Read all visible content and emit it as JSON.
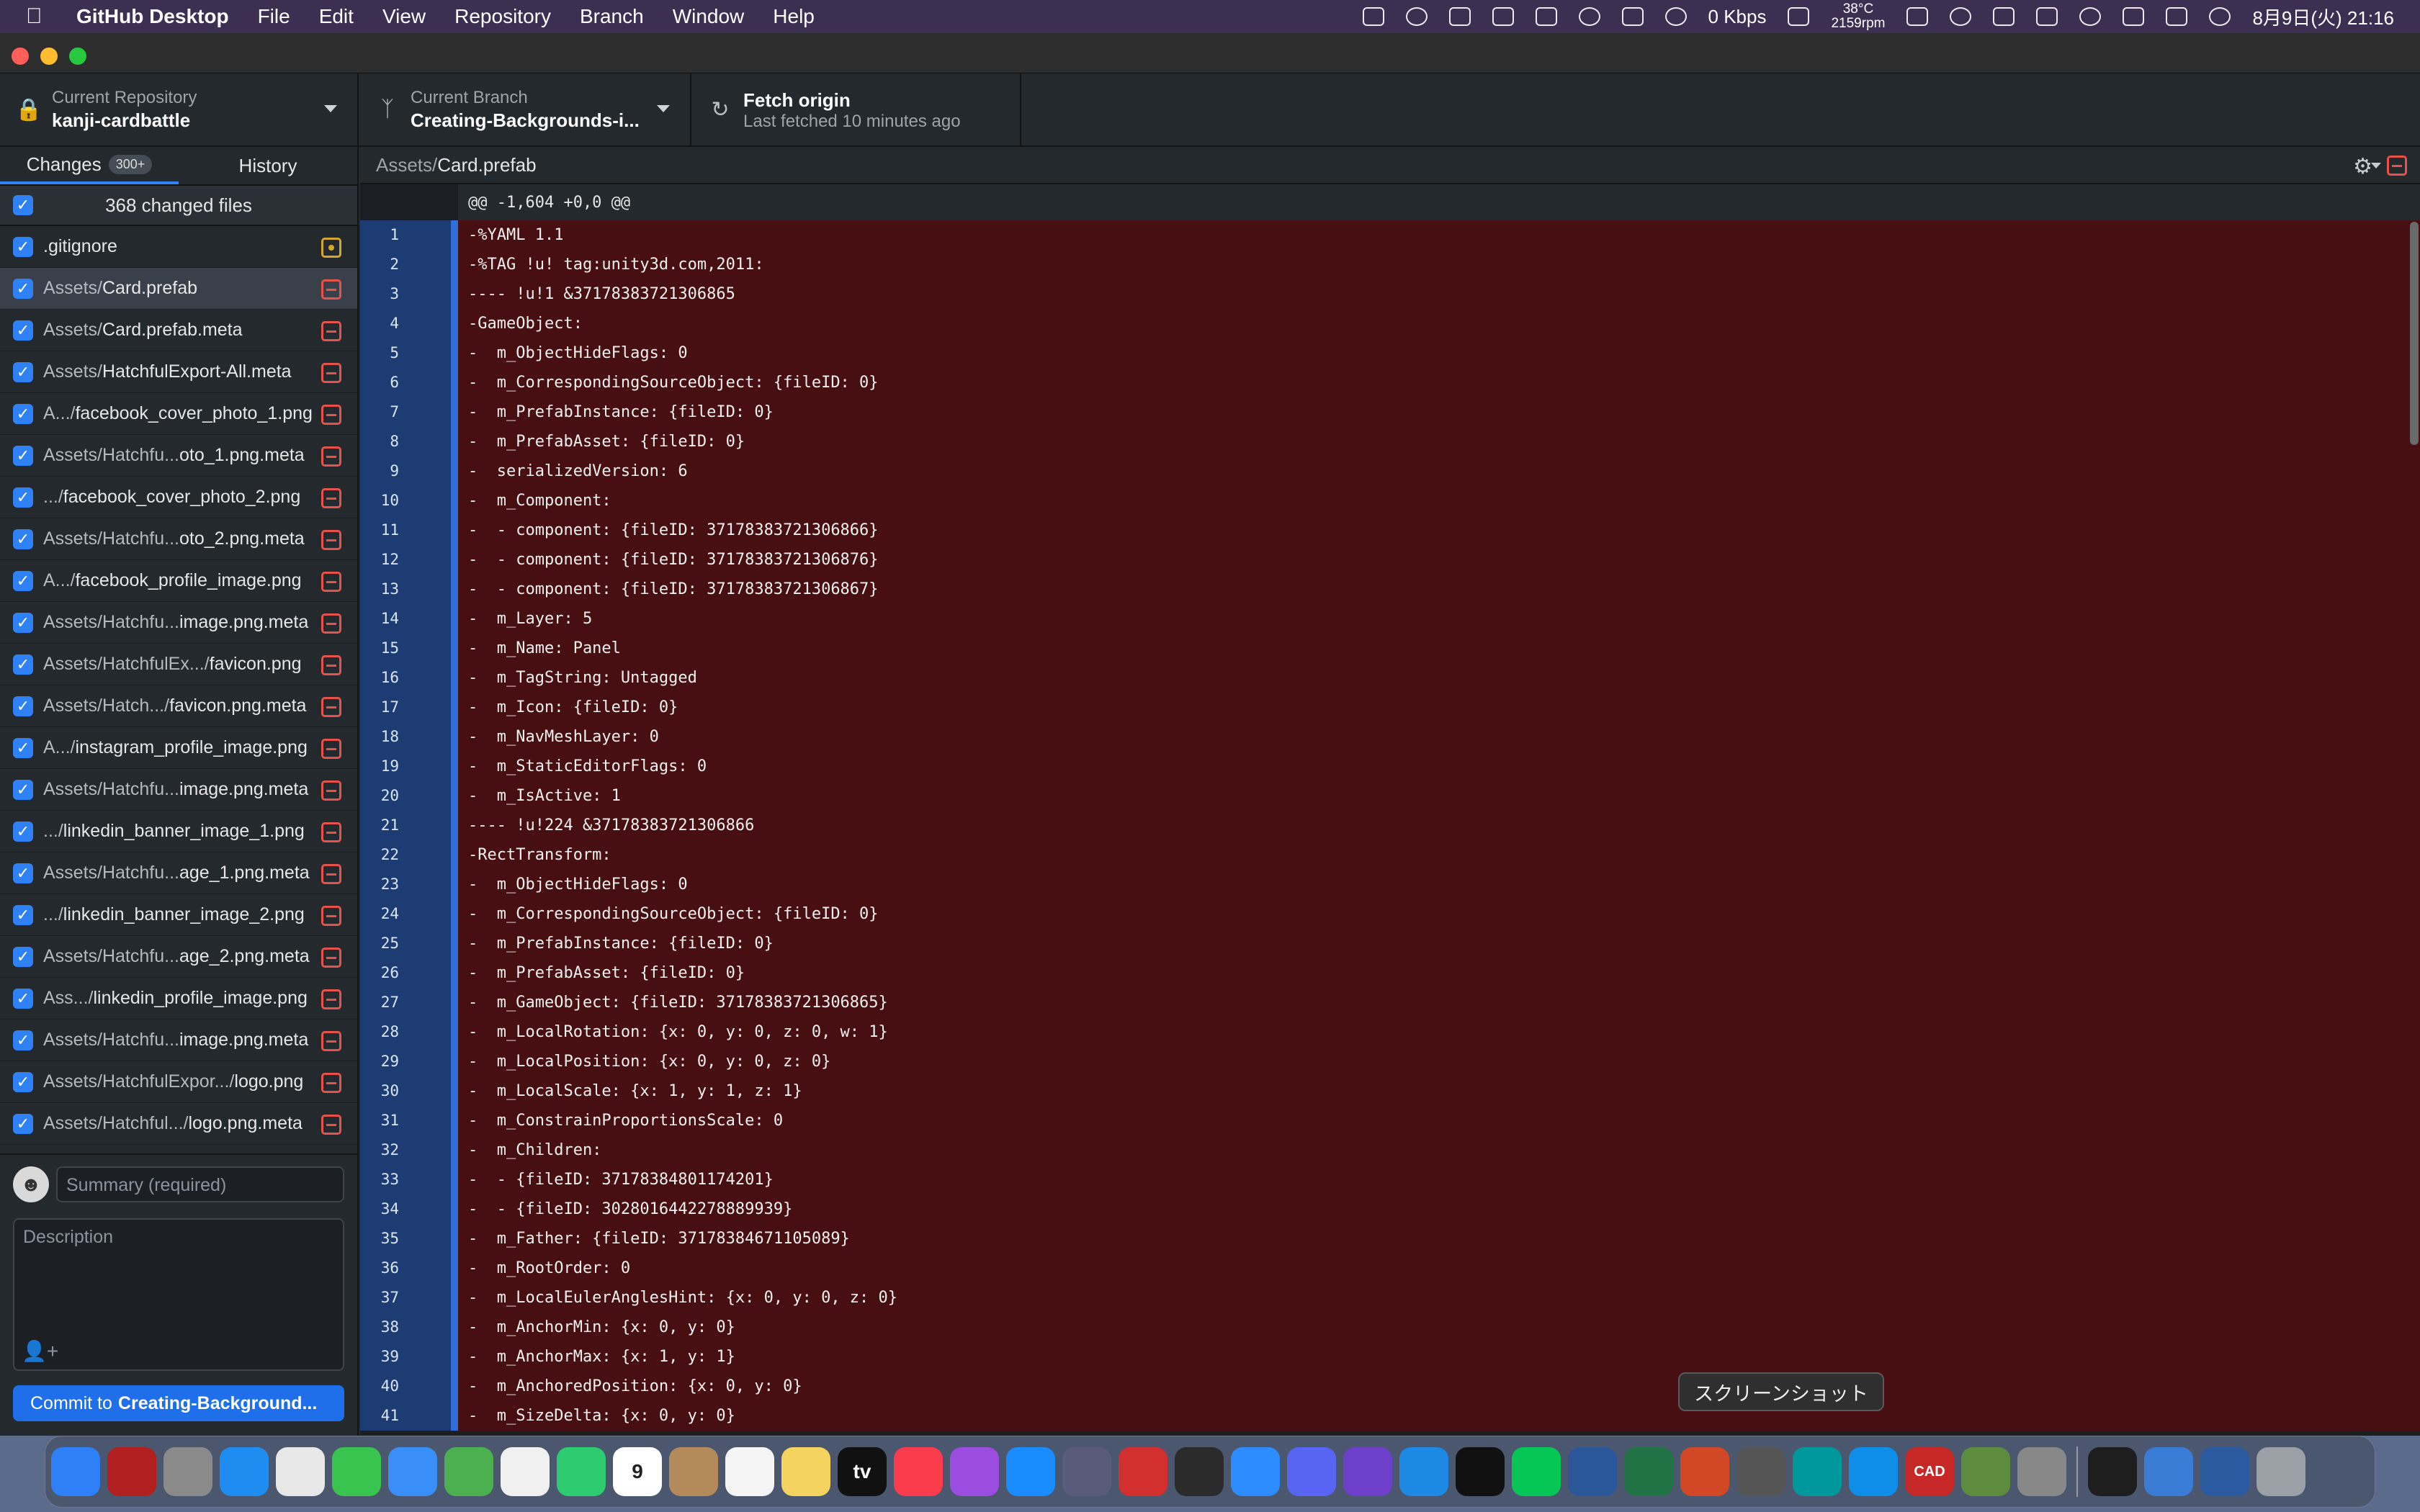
{
  "menubar": {
    "app_name": "GitHub Desktop",
    "items": [
      "File",
      "Edit",
      "View",
      "Repository",
      "Branch",
      "Window",
      "Help"
    ],
    "network": "0 Kbps",
    "temp_line1": "38°C",
    "temp_line2": "2159rpm",
    "clock": "8月9日(火) 21:16"
  },
  "toolbar": {
    "repo_label": "Current Repository",
    "repo_value": "kanji-cardbattle",
    "branch_label": "Current Branch",
    "branch_value": "Creating-Backgrounds-i...",
    "fetch_label": "Fetch origin",
    "fetch_sub": "Last fetched 10 minutes ago"
  },
  "sidebar": {
    "tab_changes": "Changes",
    "tab_changes_badge": "300+",
    "tab_history": "History",
    "changed_files_label": "368 changed files",
    "files": [
      {
        "dir": "",
        "name": ".gitignore",
        "status": "modified"
      },
      {
        "dir": "Assets/",
        "name": "Card.prefab",
        "status": "deleted"
      },
      {
        "dir": "Assets/",
        "name": "Card.prefab.meta",
        "status": "deleted"
      },
      {
        "dir": "Assets/",
        "name": "HatchfulExport-All.meta",
        "status": "deleted"
      },
      {
        "dir": "A.../",
        "name": "facebook_cover_photo_1.png",
        "status": "deleted"
      },
      {
        "dir": "Assets/Hatchfu...",
        "name": "oto_1.png.meta",
        "status": "deleted"
      },
      {
        "dir": ".../",
        "name": "facebook_cover_photo_2.png",
        "status": "deleted"
      },
      {
        "dir": "Assets/Hatchfu...",
        "name": "oto_2.png.meta",
        "status": "deleted"
      },
      {
        "dir": "A.../",
        "name": "facebook_profile_image.png",
        "status": "deleted"
      },
      {
        "dir": "Assets/Hatchfu...",
        "name": "image.png.meta",
        "status": "deleted"
      },
      {
        "dir": "Assets/HatchfulEx.../",
        "name": "favicon.png",
        "status": "deleted"
      },
      {
        "dir": "Assets/Hatch.../",
        "name": "favicon.png.meta",
        "status": "deleted"
      },
      {
        "dir": "A.../",
        "name": "instagram_profile_image.png",
        "status": "deleted"
      },
      {
        "dir": "Assets/Hatchfu...",
        "name": "image.png.meta",
        "status": "deleted"
      },
      {
        "dir": ".../",
        "name": "linkedin_banner_image_1.png",
        "status": "deleted"
      },
      {
        "dir": "Assets/Hatchfu...",
        "name": "age_1.png.meta",
        "status": "deleted"
      },
      {
        "dir": ".../",
        "name": "linkedin_banner_image_2.png",
        "status": "deleted"
      },
      {
        "dir": "Assets/Hatchfu...",
        "name": "age_2.png.meta",
        "status": "deleted"
      },
      {
        "dir": "Ass.../",
        "name": "linkedin_profile_image.png",
        "status": "deleted"
      },
      {
        "dir": "Assets/Hatchfu...",
        "name": "image.png.meta",
        "status": "deleted"
      },
      {
        "dir": "Assets/HatchfulExpor.../",
        "name": "logo.png",
        "status": "deleted"
      },
      {
        "dir": "Assets/Hatchful.../",
        "name": "logo.png.meta",
        "status": "deleted"
      }
    ],
    "summary_placeholder": "Summary (required)",
    "description_placeholder": "Description",
    "commit_prefix": "Commit to",
    "commit_branch": "Creating-Background..."
  },
  "diff": {
    "path_dir": "Assets/",
    "path_file": "Card.prefab",
    "hunk": "@@ -1,604 +0,0 @@",
    "lines": [
      "-%YAML 1.1",
      "-%TAG !u! tag:unity3d.com,2011:",
      "---- !u!1 &37178383721306865",
      "-GameObject:",
      "-  m_ObjectHideFlags: 0",
      "-  m_CorrespondingSourceObject: {fileID: 0}",
      "-  m_PrefabInstance: {fileID: 0}",
      "-  m_PrefabAsset: {fileID: 0}",
      "-  serializedVersion: 6",
      "-  m_Component:",
      "-  - component: {fileID: 37178383721306866}",
      "-  - component: {fileID: 37178383721306876}",
      "-  - component: {fileID: 37178383721306867}",
      "-  m_Layer: 5",
      "-  m_Name: Panel",
      "-  m_TagString: Untagged",
      "-  m_Icon: {fileID: 0}",
      "-  m_NavMeshLayer: 0",
      "-  m_StaticEditorFlags: 0",
      "-  m_IsActive: 1",
      "---- !u!224 &37178383721306866",
      "-RectTransform:",
      "-  m_ObjectHideFlags: 0",
      "-  m_CorrespondingSourceObject: {fileID: 0}",
      "-  m_PrefabInstance: {fileID: 0}",
      "-  m_PrefabAsset: {fileID: 0}",
      "-  m_GameObject: {fileID: 37178383721306865}",
      "-  m_LocalRotation: {x: 0, y: 0, z: 0, w: 1}",
      "-  m_LocalPosition: {x: 0, y: 0, z: 0}",
      "-  m_LocalScale: {x: 1, y: 1, z: 1}",
      "-  m_ConstrainProportionsScale: 0",
      "-  m_Children:",
      "-  - {fileID: 37178384801174201}",
      "-  - {fileID: 3028016442278889939}",
      "-  m_Father: {fileID: 37178384671105089}",
      "-  m_RootOrder: 0",
      "-  m_LocalEulerAnglesHint: {x: 0, y: 0, z: 0}",
      "-  m_AnchorMin: {x: 0, y: 0}",
      "-  m_AnchorMax: {x: 1, y: 1}",
      "-  m_AnchoredPosition: {x: 0, y: 0}",
      "-  m_SizeDelta: {x: 0, y: 0}"
    ]
  },
  "tooltip": "スクリーンショット",
  "dock": {
    "calendar_day": "9",
    "appletv_label": "tv",
    "autocad_label": "CAD",
    "items": [
      "finder-icon",
      "filezilla-icon",
      "launchpad-icon",
      "safari-icon",
      "chrome-icon",
      "messages-icon",
      "mail-icon",
      "maps-icon",
      "photos-icon",
      "facetime-icon",
      "calendar-icon",
      "contacts-icon",
      "reminders-icon",
      "notes-icon",
      "appletv-icon",
      "music-icon",
      "podcasts-icon",
      "appstore-icon",
      "photobooth-icon",
      "acrobat-icon",
      "unity-icon",
      "zoom-icon",
      "discord-icon",
      "github-desktop-icon",
      "vscode-icon",
      "terminal-icon",
      "line-icon",
      "word-icon",
      "excel-icon",
      "powerpoint-icon",
      "screenshot-icon",
      "arduino-icon",
      "teamviewer-icon",
      "autocad-icon",
      "minecraft-icon",
      "system-preferences-icon",
      "onepassword-icon",
      "downloads-stack-icon",
      "xcode-stack-icon",
      "trash-icon"
    ]
  }
}
